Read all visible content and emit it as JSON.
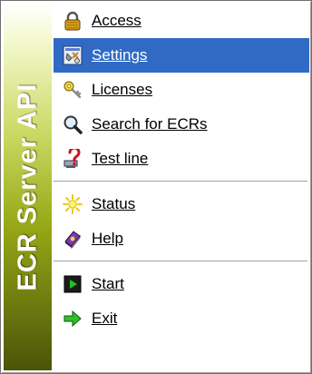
{
  "sidebar": {
    "title": "ECR Server API"
  },
  "menu": {
    "group1": [
      {
        "label": "Access",
        "icon": "lock-icon"
      },
      {
        "label": "Settings",
        "icon": "settings-icon",
        "selected": true
      },
      {
        "label": "Licenses",
        "icon": "key-icon"
      },
      {
        "label": "Search for ECRs",
        "icon": "magnifier-icon"
      },
      {
        "label": "Test line",
        "icon": "network-question-icon"
      }
    ],
    "group2": [
      {
        "label": "Status",
        "icon": "sun-icon"
      },
      {
        "label": "Help",
        "icon": "help-book-icon"
      }
    ],
    "group3": [
      {
        "label": "Start",
        "icon": "play-icon"
      },
      {
        "label": "Exit",
        "icon": "exit-arrow-icon"
      }
    ]
  },
  "colors": {
    "selection": "#316ac5",
    "sidebar_dark": "#4b5408",
    "sidebar_light": "#c9d861"
  }
}
